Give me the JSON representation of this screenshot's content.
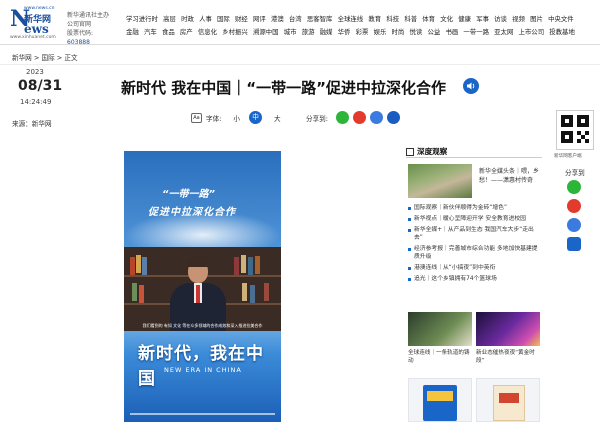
{
  "header": {
    "logo_cn": "新华网",
    "logo_en_n": "N",
    "logo_en_ews": "ews",
    "logo_url_top": "www.news.cn",
    "logo_url": "www.xinhuanet.com",
    "info_line1": "新华通讯社主办",
    "info_line2": "公司官网",
    "info_line3_label": "股票代码:",
    "info_line3_code": "603888"
  },
  "nav": {
    "row1": [
      "学习进行时",
      "高层",
      "时政",
      "人事",
      "国际",
      "财经",
      "网评",
      "港澳",
      "台湾",
      "思客智库",
      "全球连线",
      "教育",
      "科技",
      "科普",
      "体育",
      "文化",
      "健康",
      "军事",
      "访谈",
      "视频",
      "图片",
      "中央文件"
    ],
    "row2": [
      "金融",
      "汽车",
      "食品",
      "房产",
      "信息化",
      "乡村振兴",
      "溯源中国",
      "城市",
      "旅游",
      "融媒",
      "华侨",
      "彩票",
      "娱乐",
      "时尚",
      "悦读",
      "公益",
      "书画",
      "一带一路",
      "亚太网",
      "上市公司",
      "投教基地"
    ]
  },
  "breadcrumb": "新华网 > 国际 > 正文",
  "date": {
    "year": "2023",
    "md": "08/31",
    "time": "14:24:49"
  },
  "source": "来源：新华网",
  "article_title": "新时代 我在中国｜“一带一路”促进中拉深化合作",
  "font_tools": {
    "label": "字体:",
    "small": "小",
    "medium": "中",
    "large": "大"
  },
  "share_label": "分享到:",
  "video": {
    "title1": "“一带一路”",
    "title2": "促进中拉深化合作",
    "caption": "我们看到的 有如 文化 等在众多领域的合作成效和深入推进拉美合作",
    "main": "新时代，我在中国",
    "sub": "NEW ERA IN CHINA"
  },
  "sidebar": {
    "section_title": "深度观察",
    "feature_text": "新华全媒头条｜喂，乡愁！——潇惠村传奇",
    "list": [
      "国际观察｜新伙伴顺得为金砖“增色”",
      "新华视点｜暖心呈障迎开学 安全教育进校园",
      "新华全媒+｜从产品到生态 我国汽车大步“走出去”",
      "经济参考报｜完善城市综合功能 多地加快基建提质升级",
      "港澳连线｜从“小搞夜”到中英衔",
      "追光｜这个乡镇拥有74个篮球场"
    ],
    "thumb1_caption": "全球连线｜一条轨道的铸动",
    "thumb2_caption": "新业态催热夜夜“黄金时段”"
  },
  "far_right": {
    "qr_caption": "新华网客户端",
    "share_label": "分享到"
  }
}
